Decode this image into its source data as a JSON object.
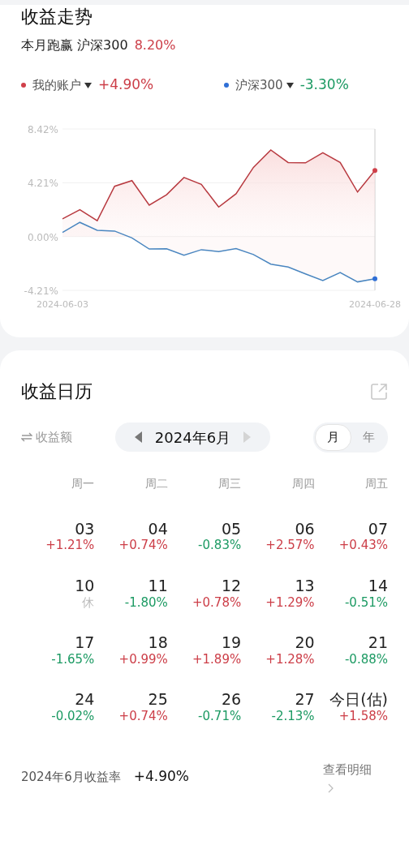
{
  "trend": {
    "title": "收益走势",
    "subtitle": "本月跑赢 沪深300",
    "outperform": "8.20%",
    "legend": [
      {
        "value": "+4.90%",
        "color": "#d0404a",
        "kind": "gain"
      },
      {
        "value": "-3.30%",
        "color": "#2f6fd6",
        "kind": "loss"
      }
    ],
    "chart_data": {
      "type": "area",
      "categories": [
        "2024-06-03",
        null,
        null,
        null,
        null,
        null,
        null,
        null,
        null,
        null,
        null,
        null,
        null,
        null,
        null,
        null,
        null,
        null,
        "2024-06-28"
      ],
      "series": [
        {
          "name": "我的账户",
          "color": "#b83a40",
          "values": [
            1.39,
            2.09,
            1.24,
            3.93,
            4.38,
            2.46,
            3.27,
            4.62,
            4.08,
            2.31,
            3.35,
            5.41,
            6.77,
            5.79,
            5.77,
            6.56,
            5.79,
            3.48,
            5.17
          ]
        },
        {
          "name": "沪深300",
          "color": "#4a86c0",
          "values": [
            0.32,
            1.11,
            0.49,
            0.43,
            -0.11,
            -0.98,
            -0.96,
            -1.47,
            -1.03,
            -1.18,
            -0.94,
            -1.41,
            -2.16,
            -2.39,
            -2.93,
            -3.44,
            -2.82,
            -3.55,
            -3.31
          ]
        }
      ],
      "ylim": [
        -4.21,
        8.42
      ],
      "yticks": [
        {
          "value": 8.42,
          "label": "8.42%"
        },
        {
          "value": 4.21,
          "label": "4.21%"
        },
        {
          "value": 0,
          "label": "0.00%"
        },
        {
          "value": -4.21,
          "label": "-4.21%"
        }
      ]
    }
  },
  "calendar": {
    "title": "收益日历",
    "metric": "收益额",
    "month": "2024年6月",
    "views": [
      {
        "label": "月",
        "selected": true
      },
      {
        "label": "年",
        "selected": false
      }
    ],
    "weekdays": [
      "周一",
      "周二",
      "周三",
      "周四",
      "周五"
    ],
    "days": [
      {
        "day": "03",
        "value": "+1.21%",
        "kind": "gain"
      },
      {
        "day": "04",
        "value": "+0.74%",
        "kind": "gain"
      },
      {
        "day": "05",
        "value": "-0.83%",
        "kind": "loss"
      },
      {
        "day": "06",
        "value": "+2.57%",
        "kind": "gain"
      },
      {
        "day": "07",
        "value": "+0.43%",
        "kind": "gain"
      },
      {
        "day": "10",
        "value": "休",
        "kind": "closed"
      },
      {
        "day": "11",
        "value": "-1.80%",
        "kind": "loss"
      },
      {
        "day": "12",
        "value": "+0.78%",
        "kind": "gain"
      },
      {
        "day": "13",
        "value": "+1.29%",
        "kind": "gain"
      },
      {
        "day": "14",
        "value": "-0.51%",
        "kind": "loss"
      },
      {
        "day": "17",
        "value": "-1.65%",
        "kind": "loss"
      },
      {
        "day": "18",
        "value": "+0.99%",
        "kind": "gain"
      },
      {
        "day": "19",
        "value": "+1.89%",
        "kind": "gain"
      },
      {
        "day": "20",
        "value": "+1.28%",
        "kind": "gain"
      },
      {
        "day": "21",
        "value": "-0.88%",
        "kind": "loss"
      },
      {
        "day": "24",
        "value": "-0.02%",
        "kind": "loss"
      },
      {
        "day": "25",
        "value": "+0.74%",
        "kind": "gain"
      },
      {
        "day": "26",
        "value": "-0.71%",
        "kind": "loss"
      },
      {
        "day": "27",
        "value": "-2.13%",
        "kind": "loss"
      },
      {
        "day": "今日(估)",
        "value": "+1.58%",
        "kind": "gain"
      }
    ],
    "summary_label": "2024年6月收益率",
    "summary_value": "+4.90%",
    "details_link": "查看明细"
  }
}
